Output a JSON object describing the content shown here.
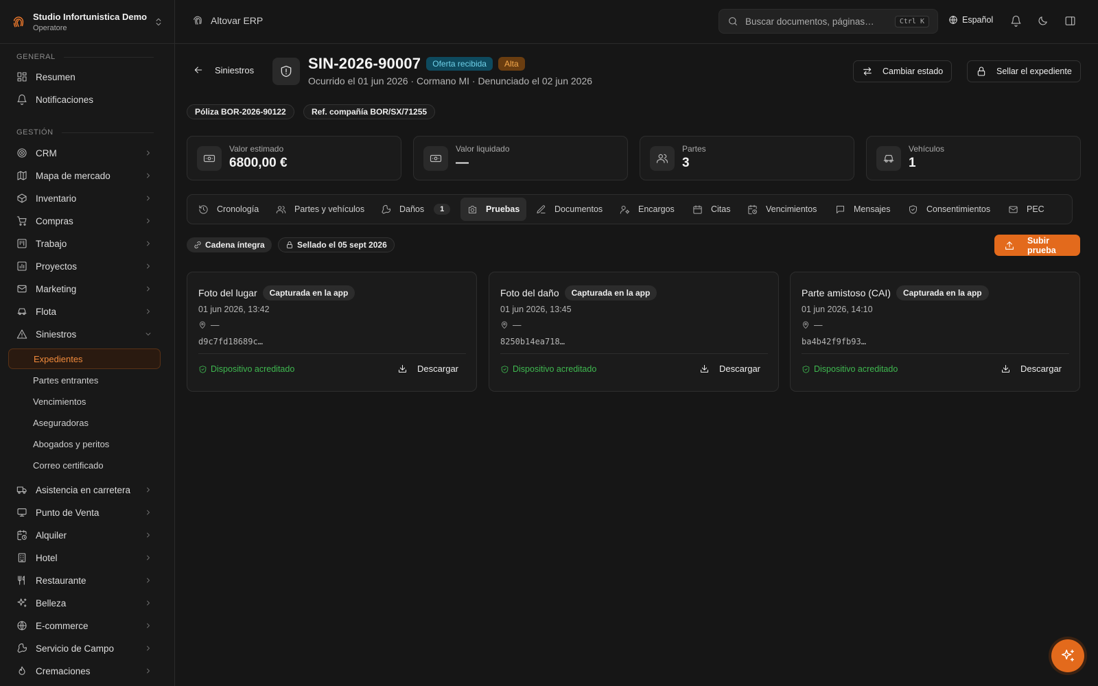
{
  "org": {
    "name": "Studio Infortunistica Demo",
    "role": "Operatore"
  },
  "sidebar": {
    "general_label": "GENERAL",
    "general": [
      {
        "label": "Resumen",
        "icon": "grid-icon"
      },
      {
        "label": "Notificaciones",
        "icon": "bell-icon"
      }
    ],
    "gestion_label": "GESTIÓN",
    "modules": [
      {
        "label": "CRM",
        "icon": "target-icon"
      },
      {
        "label": "Mapa de mercado",
        "icon": "map-icon"
      },
      {
        "label": "Inventario",
        "icon": "box-icon"
      },
      {
        "label": "Compras",
        "icon": "cart-icon"
      },
      {
        "label": "Trabajo",
        "icon": "kanban-icon"
      },
      {
        "label": "Proyectos",
        "icon": "chart-icon"
      },
      {
        "label": "Marketing",
        "icon": "mail-icon"
      },
      {
        "label": "Flota",
        "icon": "car-icon"
      },
      {
        "label": "Siniestros",
        "icon": "warning-icon"
      }
    ],
    "siniestros_sub": [
      "Expedientes",
      "Partes entrantes",
      "Vencimientos",
      "Aseguradoras",
      "Abogados y peritos",
      "Correo certificado"
    ],
    "modules_after": [
      {
        "label": "Asistencia en carretera",
        "icon": "truck-icon"
      },
      {
        "label": "Punto de Venta",
        "icon": "monitor-icon"
      },
      {
        "label": "Alquiler",
        "icon": "calendar-clock-icon"
      },
      {
        "label": "Hotel",
        "icon": "building-icon"
      },
      {
        "label": "Restaurante",
        "icon": "utensils-icon"
      },
      {
        "label": "Belleza",
        "icon": "sparkles-icon"
      },
      {
        "label": "E-commerce",
        "icon": "globe-icon"
      },
      {
        "label": "Servicio de Campo",
        "icon": "wrench-icon"
      },
      {
        "label": "Cremaciones",
        "icon": "flame-icon"
      }
    ]
  },
  "topbar": {
    "brand": "Altovar ERP",
    "search_placeholder": "Buscar documentos, páginas…",
    "search_shortcut": "Ctrl K",
    "language": "Español"
  },
  "case": {
    "back_label": "Siniestros",
    "number": "SIN-2026-90007",
    "status_badge": "Oferta recibida",
    "priority_badge": "Alta",
    "subtitle": "Ocurrido el 01 jun 2026 · Cormano MI · Denunciado el 02 jun 2026",
    "change_status": "Cambiar estado",
    "seal": "Sellar el expediente",
    "policy": "Póliza BOR-2026-90122",
    "company_ref": "Ref. compañía BOR/SX/71255"
  },
  "stats": [
    {
      "label": "Valor estimado",
      "value": "6800,00 €",
      "icon": "banknote-icon"
    },
    {
      "label": "Valor liquidado",
      "value": "—",
      "icon": "banknote-icon"
    },
    {
      "label": "Partes",
      "value": "3",
      "icon": "users-icon"
    },
    {
      "label": "Vehículos",
      "value": "1",
      "icon": "car-icon"
    }
  ],
  "tabs": [
    {
      "label": "Cronología",
      "icon": "history-icon"
    },
    {
      "label": "Partes y vehículos",
      "icon": "users-icon"
    },
    {
      "label": "Daños",
      "icon": "wrench-icon",
      "count": "1"
    },
    {
      "label": "Pruebas",
      "icon": "camera-icon",
      "active": true
    },
    {
      "label": "Documentos",
      "icon": "edit-icon"
    },
    {
      "label": "Encargos",
      "icon": "user-cog-icon"
    },
    {
      "label": "Citas",
      "icon": "calendar-icon"
    },
    {
      "label": "Vencimientos",
      "icon": "calendar-clock-icon"
    },
    {
      "label": "Mensajes",
      "icon": "message-icon"
    },
    {
      "label": "Consentimientos",
      "icon": "shield-check-icon"
    },
    {
      "label": "PEC",
      "icon": "mail-icon"
    }
  ],
  "evidence": {
    "chain_label": "Cadena íntegra",
    "sealed_label": "Sellado el 05 sept 2026",
    "upload_label": "Subir prueba",
    "items": [
      {
        "title": "Foto del lugar",
        "tag": "Capturada en la app",
        "date": "01 jun 2026, 13:42",
        "location": "—",
        "hash": "d9c7fd18689c…",
        "verified": "Dispositivo acreditado",
        "download": "Descargar"
      },
      {
        "title": "Foto del daño",
        "tag": "Capturada en la app",
        "date": "01 jun 2026, 13:45",
        "location": "—",
        "hash": "8250b14ea718…",
        "verified": "Dispositivo acreditado",
        "download": "Descargar"
      },
      {
        "title": "Parte amistoso (CAI)",
        "tag": "Capturada en la app",
        "date": "01 jun 2026, 14:10",
        "location": "—",
        "hash": "ba4b42f9fb93…",
        "verified": "Dispositivo acreditado",
        "download": "Descargar"
      }
    ]
  },
  "colors": {
    "accent": "#e36a1c",
    "success": "#3fb950",
    "status_blue": "#6fd2ea",
    "priority_orange": "#f5a94c"
  }
}
